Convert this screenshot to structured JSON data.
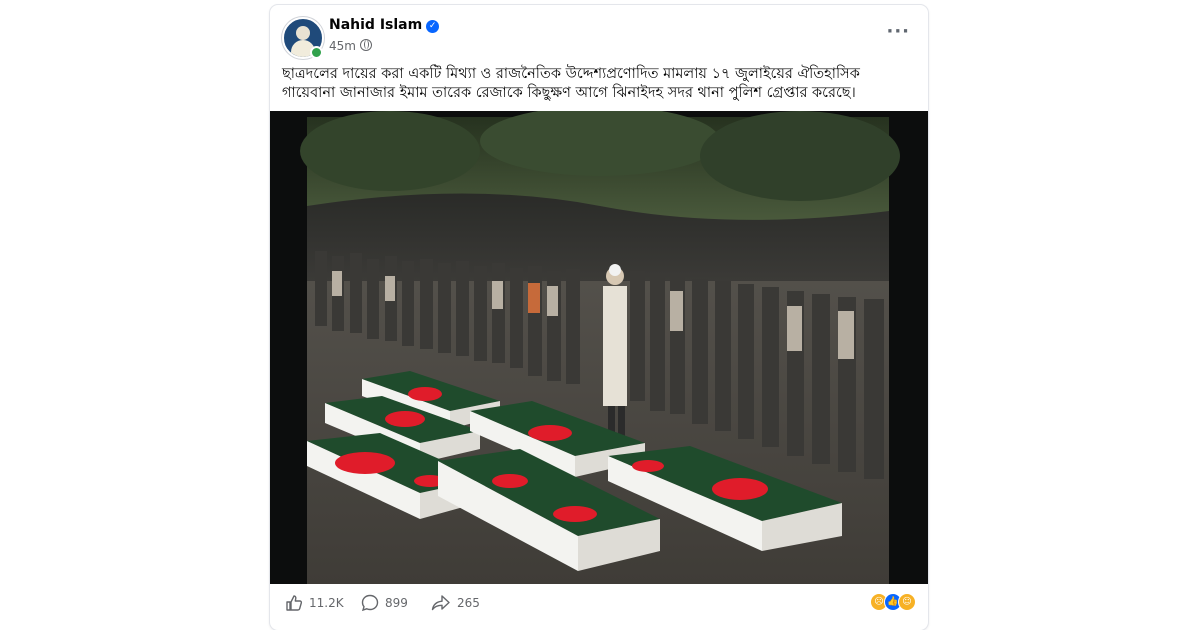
{
  "post": {
    "author": "Nahid Islam",
    "time": "45m",
    "caption": "ছাত্রদলের দায়ের করা একটি মিথ্যা ও রাজনৈতিক উদ্দেশ্যপ্রণোদিত মামলায় ১৭ জুলাইয়ের ঐতিহাসিক গায়েবানা জানাজার ইমাম তারেক রেজাকে কিছুক্ষণ আগে ঝিনাইদহ সদর থানা পুলিশ গ্রেপ্তার করেছে।",
    "more_icon": "more-options-icon",
    "privacy_icon": "globe-icon"
  },
  "stats": {
    "likes": "11.2K",
    "comments": "899",
    "shares": "265"
  },
  "reactions": [
    "sad",
    "like",
    "haha"
  ],
  "colors": {
    "accent": "#0866ff",
    "flag_green": "#1f4b2c",
    "flag_red": "#e01c2a"
  }
}
